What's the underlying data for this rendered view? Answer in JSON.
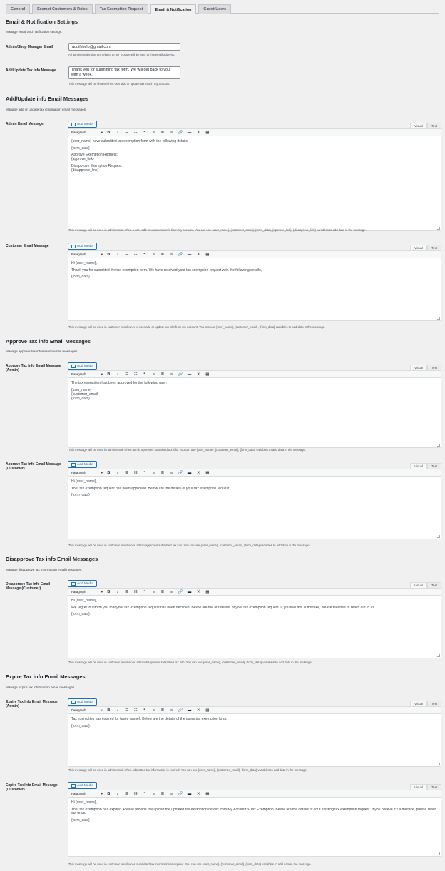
{
  "tabs": [
    {
      "label": "General"
    },
    {
      "label": "Exempt Customers & Roles"
    },
    {
      "label": "Tax Exemption Request"
    },
    {
      "label": "Email & Notification"
    },
    {
      "label": "Guest Users"
    }
  ],
  "active_tab": "Email & Notification",
  "settings": {
    "title": "Email & Notification Settings",
    "description": "Manage email and notification settings.",
    "admin_email": {
      "label": "Admin/Shop Manager Email",
      "value": "addifyhelp@gmail.com",
      "help": "All admin emails that are related to our module will be sent to this email address."
    },
    "update_msg": {
      "label": "Add/Update Tax Info Message",
      "value": "Thank you for submitting tax form. We will get back to you with a week.",
      "help": "This message will be shown when user add or update tax info in my account."
    }
  },
  "editor_ui": {
    "add_media": "Add Media",
    "visual": "Visual",
    "text": "Text",
    "format": "Paragraph"
  },
  "sections": {
    "add_update": {
      "title": "Add/Update info Email Messages",
      "description": "Manage add or update tax information email messages.",
      "admin": {
        "label": "Admin Email Message",
        "paragraphs": [
          "{user_name} have submitted tax exemption form with the following details.",
          "{form_data}",
          "Approve Exemption Request:",
          "{approve_link}",
          "Disapprove Exemption Request:",
          "{disapprove_link}"
        ],
        "help": "This message will be used in admin email when a user add or update tax info from my account. You can use {user_name}, {customer_email}, {form_data}, {approve_link}, {disapprove_link} variables to add data in the message."
      },
      "customer": {
        "label": "Customer Email Message",
        "paragraphs": [
          "Hi {user_name},",
          "Thank you for submitted the tax exemption form. We have received your tax exemption request with the following details,",
          "{form_data}"
        ],
        "help": "This message will be used in customer email when a user add or update tax info from my account. You can use {user_name}, {customer_email}, {form_data} variables to add data in the message."
      }
    },
    "approve": {
      "title": "Approve Tax info Email Messages",
      "description": "Manage approve tax information email messages.",
      "admin": {
        "label": "Approve Tax Info Email Message (Admin)",
        "paragraphs": [
          "The tax exemption has been approved for the following user,",
          "{user_name}",
          "{customer_email}",
          "{form_data}"
        ],
        "help": "This message will be used in admin email when admin approves submitted tax info. You can use {user_name}, {customer_email}, {form_data} variables to add data in the message."
      },
      "customer": {
        "label": "Approve Tax Info Email Message (Customer)",
        "paragraphs": [
          "Hi {user_name},",
          "Your tax exemption request has been approved. Below are the details of your tax exemption request,",
          "{form_data}"
        ],
        "help": "This message will be used in customer email when admin approves submitted tax info. You can use {user_name}, {customer_email}, {form_data} variables to add data in the message."
      }
    },
    "disapprove": {
      "title": "Disapprove Tax info Email Messages",
      "description": "Manage disapprove tax information email messages.",
      "customer": {
        "label": "Disapprove Tax Info Email Message (Customer)",
        "paragraphs": [
          "Hi {user_name},",
          "We regret to inform you that your tax exemption request has been declined. Below are the are details of your tax exemption request. If you feel this is mistake, please feel free to reach out to us.",
          "{form_data}"
        ],
        "help": "This message will be used in customer email when admin disapprove submitted tax info. You can use {user_name}, {customer_email}, {form_data} variables to add data in the message."
      }
    },
    "expire": {
      "title": "Expire Tax info Email Messages",
      "description": "Manage expire tax information email messages.",
      "admin": {
        "label": "Expire Tax Info Email Message (Admin)",
        "paragraphs": [
          "Tax exemption has expired for {user_name}. Below are the details of the users tax exemption form,",
          "{form_data}"
        ],
        "help": "This message will be used in admin email when submitted tax information is expired. You can use {user_name}, {customer_email}, {form_data} variables to add data in the message."
      },
      "customer": {
        "label": "Expire Tax Info Email Message (Customer)",
        "paragraphs": [
          "Hi {user_name},",
          "Your tax exemption has expired. Please provide the upload the updated tax exemption details from My Account > Tax Exemption. Below are the details of your existing tax exemption request. If you believe it's a mistake, please reach out to us.",
          "{form_data}"
        ],
        "help": "This message will be used in customer email when submitted tax information is expired. You can use {user_name}, {customer_email}, {form_data} variables to add data in the message."
      }
    }
  }
}
